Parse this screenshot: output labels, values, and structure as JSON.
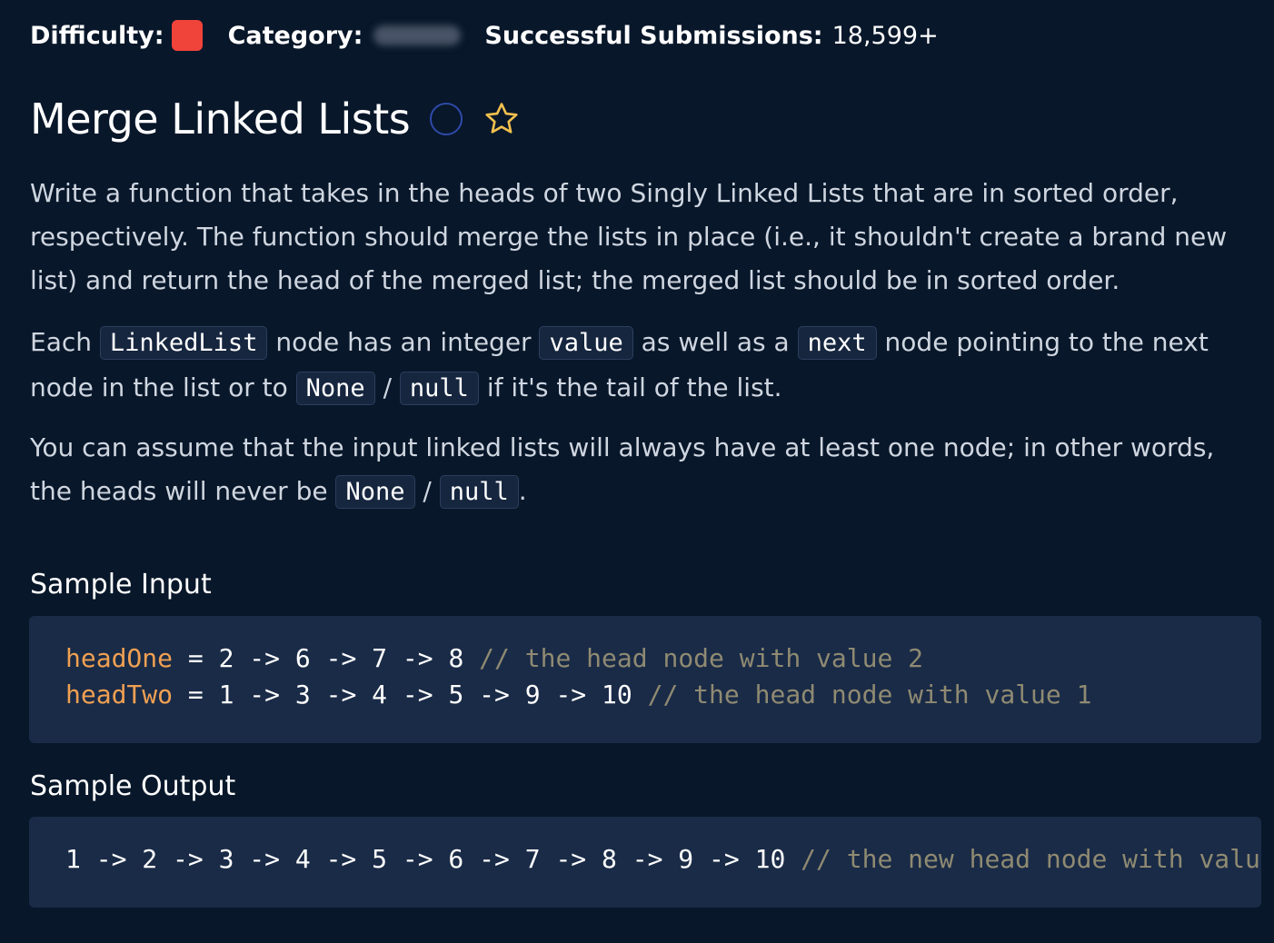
{
  "header": {
    "difficulty_label": "Difficulty:",
    "difficulty_color": "#f0433a",
    "category_label": "Category:",
    "submissions_label": "Successful Submissions:",
    "submissions_value": "18,599+"
  },
  "title": "Merge Linked Lists",
  "icons": {
    "status": "circle-icon",
    "favorite": "star-icon",
    "star_color": "#f2c14e"
  },
  "description": {
    "p1": "Write a function that takes in the heads of two Singly Linked Lists that are in sorted order, respectively. The function should merge the lists in place (i.e., it shouldn't create a brand new list) and return the head of the merged list; the merged list should be in sorted order.",
    "p2": {
      "t1": "Each ",
      "c1": "LinkedList",
      "t2": " node has an integer ",
      "c2": "value",
      "t3": " as well as a ",
      "c3": "next",
      "t4": " node pointing to the next node in the list or to ",
      "c4": "None",
      "t5": " / ",
      "c5": "null",
      "t6": " if it's the tail of the list."
    },
    "p3": {
      "t1": "You can assume that the input linked lists will always have at least one node; in other words, the heads will never be ",
      "c1": "None",
      "t2": " / ",
      "c2": "null",
      "t3": "."
    }
  },
  "sample_input": {
    "heading": "Sample Input",
    "line1": {
      "var": "headOne",
      "code": " = 2 -> 6 -> 7 -> 8 ",
      "comment": "// the head node with value 2"
    },
    "line2": {
      "var": "headTwo",
      "code": " = 1 -> 3 -> 4 -> 5 -> 9 -> 10 ",
      "comment": "// the head node with value 1"
    }
  },
  "sample_output": {
    "heading": "Sample Output",
    "code": "1 -> 2 -> 3 -> 4 -> 5 -> 6 -> 7 -> 8 -> 9 -> 10 ",
    "comment": "// the new head node with valu"
  }
}
